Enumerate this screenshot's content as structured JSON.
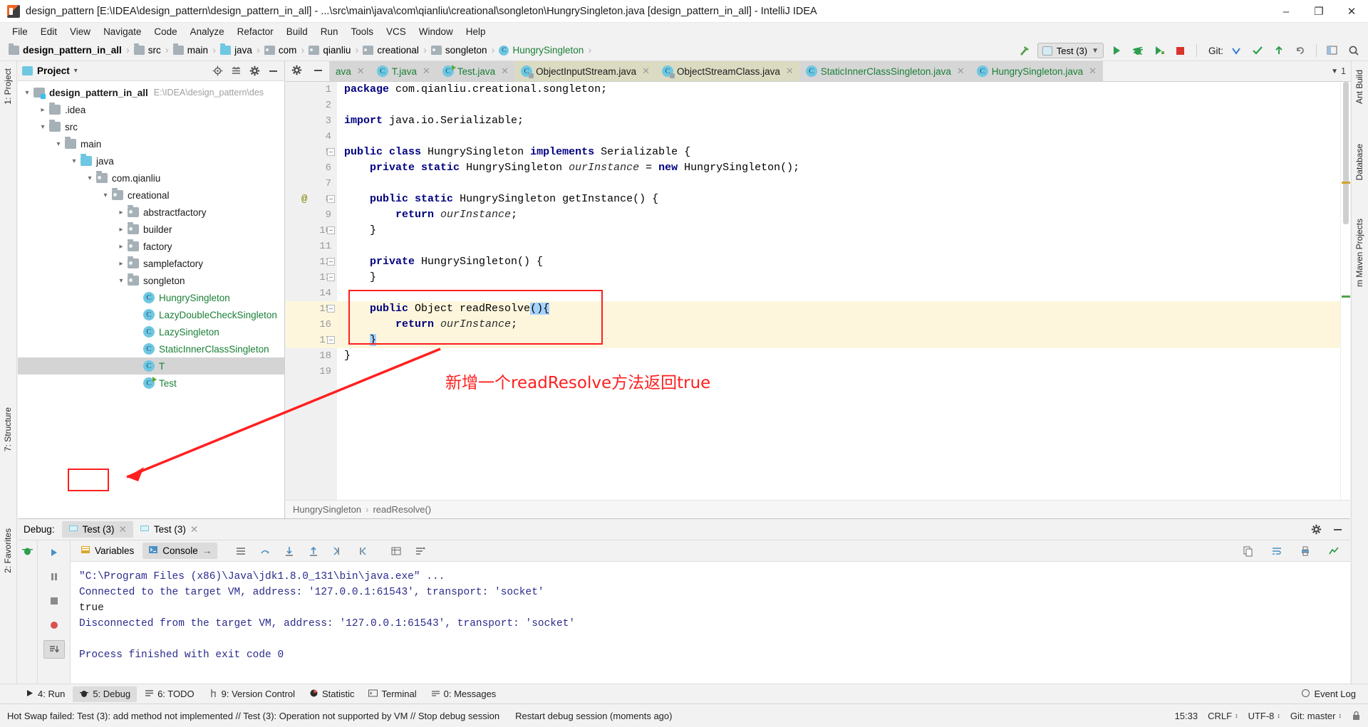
{
  "window": {
    "title": "design_pattern [E:\\IDEA\\design_pattern\\design_pattern_in_all] - ...\\src\\main\\java\\com\\qianliu\\creational\\songleton\\HungrySingleton.java [design_pattern_in_all] - IntelliJ IDEA",
    "minimize": "–",
    "maximize": "❐",
    "close": "✕"
  },
  "menubar": [
    {
      "label": "File"
    },
    {
      "label": "Edit"
    },
    {
      "label": "View"
    },
    {
      "label": "Navigate"
    },
    {
      "label": "Code"
    },
    {
      "label": "Analyze"
    },
    {
      "label": "Refactor"
    },
    {
      "label": "Build"
    },
    {
      "label": "Run"
    },
    {
      "label": "Tools"
    },
    {
      "label": "VCS"
    },
    {
      "label": "Window"
    },
    {
      "label": "Help"
    }
  ],
  "navbar": {
    "crumbs": [
      {
        "label": "design_pattern_in_all",
        "icon": "module-folder-icon",
        "style": "bold"
      },
      {
        "label": "src",
        "icon": "folder-icon",
        "style": "normal"
      },
      {
        "label": "main",
        "icon": "folder-icon",
        "style": "normal"
      },
      {
        "label": "java",
        "icon": "source-folder-icon",
        "style": "normal"
      },
      {
        "label": "com",
        "icon": "package-icon",
        "style": "normal"
      },
      {
        "label": "qianliu",
        "icon": "package-icon",
        "style": "normal"
      },
      {
        "label": "creational",
        "icon": "package-icon",
        "style": "normal"
      },
      {
        "label": "songleton",
        "icon": "package-icon",
        "style": "normal"
      },
      {
        "label": "HungrySingleton",
        "icon": "class-icon",
        "style": "green"
      }
    ],
    "separator": "›",
    "run_config": "Test (3)",
    "git_label": "Git:",
    "buttons": [
      {
        "name": "build-hammer-icon"
      },
      {
        "name": "run-button"
      },
      {
        "name": "debug-button"
      },
      {
        "name": "run-coverage-button"
      },
      {
        "name": "stop-button"
      },
      {
        "name": "update-project-button"
      },
      {
        "name": "commit-button"
      },
      {
        "name": "push-button"
      },
      {
        "name": "rollback-button"
      },
      {
        "name": "layout-button"
      },
      {
        "name": "search-everywhere-button"
      }
    ]
  },
  "project_panel": {
    "title": "Project",
    "dropdown": "▾",
    "tree": [
      {
        "label": "design_pattern_in_all",
        "path": "E:\\IDEA\\design_pattern\\des",
        "indent": 0,
        "arrow": "expanded",
        "icon": "module-folder-icon",
        "style": "bold"
      },
      {
        "label": ".idea",
        "path": "",
        "indent": 1,
        "arrow": "collapsed",
        "icon": "folder-icon",
        "style": "normal"
      },
      {
        "label": "src",
        "path": "",
        "indent": 1,
        "arrow": "expanded",
        "icon": "folder-icon",
        "style": "normal"
      },
      {
        "label": "main",
        "path": "",
        "indent": 2,
        "arrow": "expanded",
        "icon": "folder-icon",
        "style": "normal"
      },
      {
        "label": "java",
        "path": "",
        "indent": 3,
        "arrow": "expanded",
        "icon": "source-folder-icon",
        "style": "normal"
      },
      {
        "label": "com.qianliu",
        "path": "",
        "indent": 4,
        "arrow": "expanded",
        "icon": "package-icon",
        "style": "normal"
      },
      {
        "label": "creational",
        "path": "",
        "indent": 5,
        "arrow": "expanded",
        "icon": "package-icon",
        "style": "normal"
      },
      {
        "label": "abstractfactory",
        "path": "",
        "indent": 6,
        "arrow": "collapsed",
        "icon": "package-icon",
        "style": "normal"
      },
      {
        "label": "builder",
        "path": "",
        "indent": 6,
        "arrow": "collapsed",
        "icon": "package-icon",
        "style": "normal"
      },
      {
        "label": "factory",
        "path": "",
        "indent": 6,
        "arrow": "collapsed",
        "icon": "package-icon",
        "style": "normal"
      },
      {
        "label": "samplefactory",
        "path": "",
        "indent": 6,
        "arrow": "collapsed",
        "icon": "package-icon",
        "style": "normal"
      },
      {
        "label": "songleton",
        "path": "",
        "indent": 6,
        "arrow": "expanded",
        "icon": "package-icon",
        "style": "normal"
      },
      {
        "label": "HungrySingleton",
        "path": "",
        "indent": 7,
        "arrow": "none",
        "icon": "class-icon",
        "style": "green"
      },
      {
        "label": "LazyDoubleCheckSingleton",
        "path": "",
        "indent": 7,
        "arrow": "none",
        "icon": "class-icon",
        "style": "green"
      },
      {
        "label": "LazySingleton",
        "path": "",
        "indent": 7,
        "arrow": "none",
        "icon": "class-icon",
        "style": "green"
      },
      {
        "label": "StaticInnerClassSingleton",
        "path": "",
        "indent": 7,
        "arrow": "none",
        "icon": "class-icon",
        "style": "green"
      },
      {
        "label": "T",
        "path": "",
        "indent": 7,
        "arrow": "none",
        "icon": "class-icon",
        "style": "green",
        "selected": true
      },
      {
        "label": "Test",
        "path": "",
        "indent": 7,
        "arrow": "none",
        "icon": "runnable-class-icon",
        "style": "green"
      }
    ]
  },
  "editor": {
    "tabs": [
      {
        "label": "ava",
        "icon": "class-icon",
        "style": "green",
        "kind": "project",
        "truncated": true
      },
      {
        "label": "T.java",
        "icon": "class-icon",
        "style": "green",
        "kind": "project"
      },
      {
        "label": "Test.java",
        "icon": "runnable-class-icon",
        "style": "green",
        "kind": "project"
      },
      {
        "label": "ObjectInputStream.java",
        "icon": "library-class-icon",
        "style": "dark",
        "kind": "library"
      },
      {
        "label": "ObjectStreamClass.java",
        "icon": "library-class-icon",
        "style": "dark",
        "kind": "library"
      },
      {
        "label": "StaticInnerClassSingleton.java",
        "icon": "class-icon",
        "style": "green",
        "kind": "project"
      },
      {
        "label": "HungrySingleton.java",
        "icon": "class-icon",
        "style": "green",
        "kind": "project",
        "active": true
      }
    ],
    "tab_overflow": "1",
    "lines": [
      {
        "n": 1,
        "text": "package com.qianliu.creational.songleton;"
      },
      {
        "n": 2,
        "text": ""
      },
      {
        "n": 3,
        "text": "import java.io.Serializable;"
      },
      {
        "n": 4,
        "text": ""
      },
      {
        "n": 5,
        "text": "public class HungrySingleton implements Serializable {"
      },
      {
        "n": 6,
        "text": "    private static HungrySingleton ourInstance = new HungrySingleton();"
      },
      {
        "n": 7,
        "text": ""
      },
      {
        "n": 8,
        "text": "    public static HungrySingleton getInstance() {"
      },
      {
        "n": 9,
        "text": "        return ourInstance;"
      },
      {
        "n": 10,
        "text": "    }"
      },
      {
        "n": 11,
        "text": ""
      },
      {
        "n": 12,
        "text": "    private HungrySingleton() {"
      },
      {
        "n": 13,
        "text": "    }"
      },
      {
        "n": 14,
        "text": ""
      },
      {
        "n": 15,
        "text": "    public Object readResolve(){"
      },
      {
        "n": 16,
        "text": "        return ourInstance;"
      },
      {
        "n": 17,
        "text": "    }"
      },
      {
        "n": 18,
        "text": "}"
      },
      {
        "n": 19,
        "text": ""
      }
    ],
    "annotation_marker": "@",
    "breadcrumb": [
      "HungrySingleton",
      "readResolve()"
    ]
  },
  "debug": {
    "label": "Debug:",
    "tabs": [
      {
        "label": "Test (3)",
        "active": true
      },
      {
        "label": "Test (3)",
        "active": false
      }
    ],
    "subtabs": [
      {
        "label": "Variables",
        "icon": "variables-icon",
        "active": false
      },
      {
        "label": "Console",
        "icon": "console-icon",
        "active": true,
        "suffix": "→"
      }
    ],
    "console_lines": [
      {
        "text": "\"C:\\Program Files (x86)\\Java\\jdk1.8.0_131\\bin\\java.exe\" ...",
        "type": "sys"
      },
      {
        "text": "Connected to the target VM, address: '127.0.0.1:61543', transport: 'socket'",
        "type": "sys"
      },
      {
        "text": "true",
        "type": "out"
      },
      {
        "text": "Disconnected from the target VM, address: '127.0.0.1:61543', transport: 'socket'",
        "type": "sys"
      },
      {
        "text": "",
        "type": "sys"
      },
      {
        "text": "Process finished with exit code 0",
        "type": "sys"
      }
    ]
  },
  "tool_window_bar": {
    "left_tabs": [
      {
        "label": "1: Project",
        "name": "tool-window-project"
      },
      {
        "label": "7: Structure",
        "name": "tool-window-structure"
      },
      {
        "label": "2: Favorites",
        "name": "tool-window-favorites"
      }
    ],
    "right_tabs": [
      {
        "label": "Ant Build",
        "name": "tool-window-ant-build"
      },
      {
        "label": "Database",
        "name": "tool-window-database"
      },
      {
        "label": "m Maven Projects",
        "name": "tool-window-maven"
      }
    ],
    "bottom": [
      {
        "label": "4: Run",
        "icon": "run-icon",
        "active": false
      },
      {
        "label": "5: Debug",
        "icon": "debug-icon",
        "active": true
      },
      {
        "label": "6: TODO",
        "icon": "todo-icon",
        "active": false
      },
      {
        "label": "9: Version Control",
        "icon": "vcs-icon",
        "active": false
      },
      {
        "label": "Statistic",
        "icon": "statistic-icon",
        "active": false
      },
      {
        "label": "Terminal",
        "icon": "terminal-icon",
        "active": false
      },
      {
        "label": "0: Messages",
        "icon": "messages-icon",
        "active": false
      }
    ],
    "event_log": "Event Log"
  },
  "statusbar": {
    "message": "Hot Swap failed: Test (3): add method not implemented // Test (3): Operation not supported by VM // Stop debug session",
    "restart": "Restart debug session (moments ago)",
    "time": "15:33",
    "line_ending": "CRLF",
    "encoding": "UTF-8",
    "branch": "Git: master"
  },
  "annotations": {
    "note_text": "新增一个readResolve方法返回true",
    "color": "#ff1f1f"
  }
}
